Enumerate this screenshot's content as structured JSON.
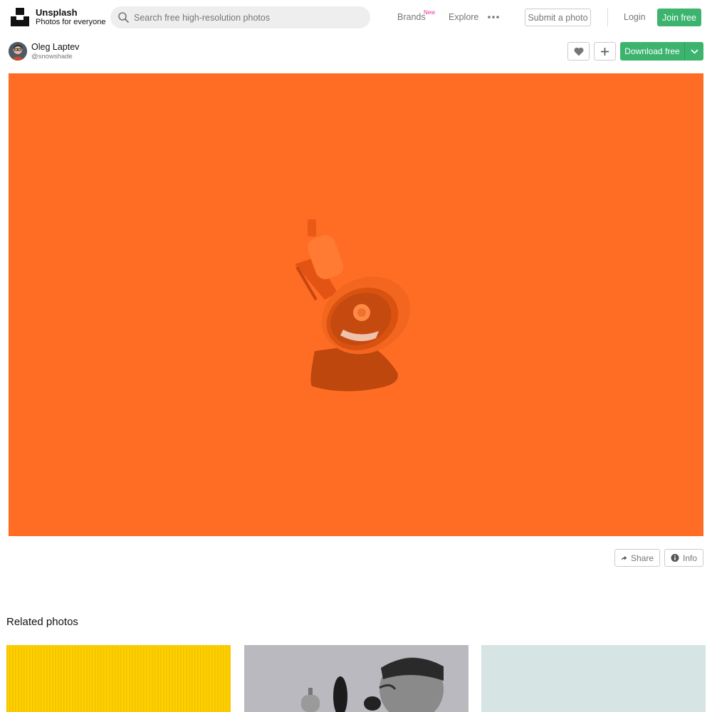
{
  "header": {
    "brand_name": "Unsplash",
    "brand_tagline": "Photos for everyone",
    "search_placeholder": "Search free high-resolution photos",
    "nav": {
      "brands_label": "Brands",
      "brands_badge": "New",
      "explore_label": "Explore"
    },
    "submit_label": "Submit a photo",
    "login_label": "Login",
    "join_label": "Join free"
  },
  "photographer": {
    "name": "Oleg Laptev",
    "handle": "@snowshade"
  },
  "actions": {
    "like_icon": "heart-icon",
    "add_icon": "plus-icon",
    "download_label": "Download free",
    "download_menu_icon": "chevron-down-icon"
  },
  "photo_footer": {
    "share_label": "Share",
    "info_label": "Info"
  },
  "related": {
    "title": "Related photos"
  },
  "colors": {
    "accent_green": "#3cb46e",
    "badge_pink": "#e62ca0",
    "photo_orange": "#ff6c24",
    "muted_text": "#767676"
  }
}
